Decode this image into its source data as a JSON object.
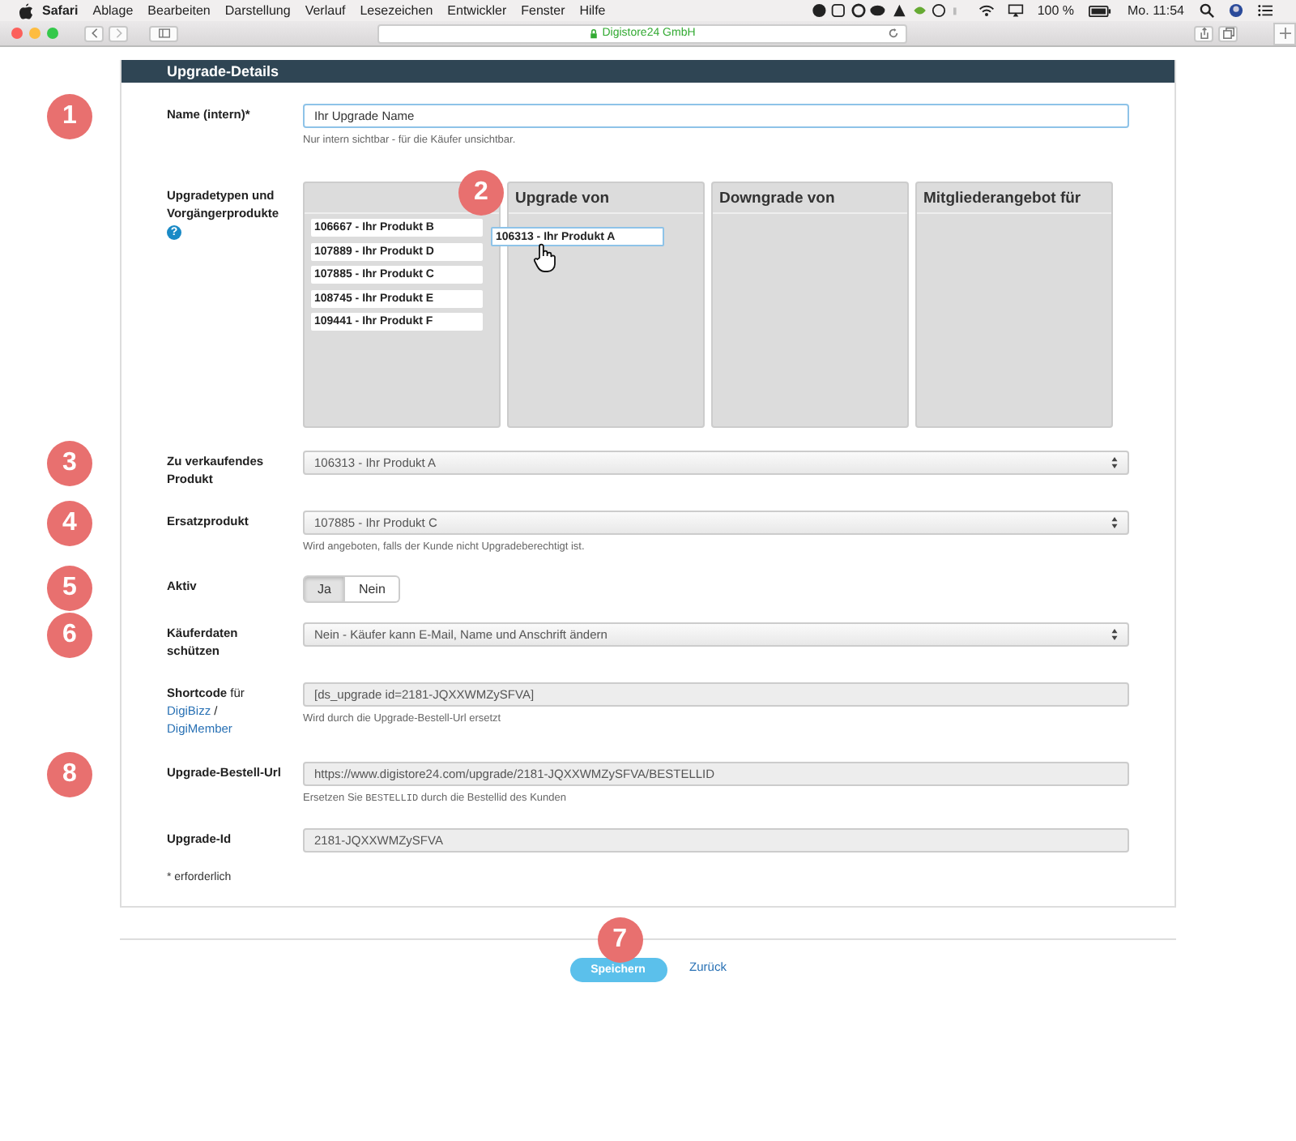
{
  "menubar": {
    "items": [
      {
        "label": "Safari",
        "bold": true
      },
      {
        "label": "Ablage",
        "bold": false
      },
      {
        "label": "Bearbeiten",
        "bold": false
      },
      {
        "label": "Darstellung",
        "bold": false
      },
      {
        "label": "Verlauf",
        "bold": false
      },
      {
        "label": "Lesezeichen",
        "bold": false
      },
      {
        "label": "Entwickler",
        "bold": false
      },
      {
        "label": "Fenster",
        "bold": false
      },
      {
        "label": "Hilfe",
        "bold": false
      }
    ],
    "battery": "100 %",
    "clock": "Mo. 11:54"
  },
  "browser": {
    "address": "Digistore24 GmbH"
  },
  "panel": {
    "title": "Upgrade-Details",
    "fields": [
      {
        "kind": "text",
        "marker": "1",
        "label": "Name (intern)*",
        "value": "Ihr Upgrade Name",
        "hint": "Nur intern sichtbar - für die Käufer unsichtbar."
      },
      {
        "kind": "dragdrop",
        "marker": "2",
        "label": "Upgradetypen und Vorgängerprodukte",
        "help": "?",
        "source": [
          "106667 - Ihr Produkt B",
          "107889 - Ihr Produkt D",
          "107885 - Ihr Produkt C",
          "108745 - Ihr Produkt E",
          "109441 - Ihr Produkt F"
        ],
        "columns": [
          "Upgrade von",
          "Downgrade von",
          "Mitgliederangebot für"
        ],
        "dragged": "106313 - Ihr Produkt A"
      },
      {
        "kind": "select",
        "marker": "3",
        "label": "Zu verkaufendes Produkt",
        "value": "106313 - Ihr Produkt A"
      },
      {
        "kind": "select",
        "marker": "4",
        "label": "Ersatzprodukt",
        "value": "107885 - Ihr Produkt C",
        "hint": "Wird angeboten, falls der Kunde nicht Upgradeberechtigt ist."
      },
      {
        "kind": "toggle",
        "marker": "5",
        "label": "Aktiv",
        "options": [
          {
            "label": "Ja",
            "selected": true
          },
          {
            "label": "Nein",
            "selected": false
          }
        ]
      },
      {
        "kind": "select",
        "marker": "6",
        "label": "Käuferdaten schützen",
        "value": "Nein - Käufer kann E-Mail, Name und Anschrift ändern"
      },
      {
        "kind": "readonly",
        "label": "**Shortcode** für",
        "links": [
          "DigiBizz",
          "DigiMember"
        ],
        "link_separator": "/",
        "value": "[ds_upgrade id=2181-JQXXWMZySFVA]",
        "hint": "Wird durch die Upgrade-Bestell-Url ersetzt"
      },
      {
        "kind": "readonly",
        "marker": "8",
        "label": "Upgrade-Bestell-Url",
        "value": "https://www.digistore24.com/upgrade/2181-JQXXWMZySFVA/BESTELLID",
        "hint_parts": [
          {
            "text": "Ersetzen Sie ",
            "mono": false
          },
          {
            "text": "BESTELLID",
            "mono": true
          },
          {
            "text": " durch die Bestellid des Kunden",
            "mono": false
          }
        ]
      },
      {
        "kind": "readonly",
        "label": "Upgrade-Id",
        "value": "2181-JQXXWMZySFVA"
      }
    ],
    "required_note": "* erforderlich"
  },
  "footer": {
    "marker": "7",
    "save": "Speichern",
    "back": "Zurück"
  }
}
